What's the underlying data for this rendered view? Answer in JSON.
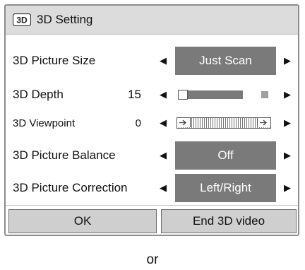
{
  "dialog": {
    "title": "3D Setting",
    "icon": "3d-badge-icon"
  },
  "rows": [
    {
      "label": "3D Picture Size",
      "type": "select",
      "value": "Just Scan"
    },
    {
      "label": "3D Depth",
      "type": "slider",
      "number": "15",
      "level_fraction": 0.75
    },
    {
      "label": "3D Viewpoint",
      "type": "slider",
      "number": "0",
      "level_fraction": 0.5
    },
    {
      "label": "3D Picture Balance",
      "type": "select",
      "value": "Off"
    },
    {
      "label": "3D Picture Correction",
      "type": "select",
      "value": "Left/Right"
    }
  ],
  "buttons": {
    "ok": "OK",
    "end": "End 3D video"
  },
  "footer": {
    "or": "or"
  },
  "colors": {
    "title_bg": "#dcdcdc",
    "value_box": "#7a7a7a",
    "button_bg": "#cfcfcf"
  }
}
